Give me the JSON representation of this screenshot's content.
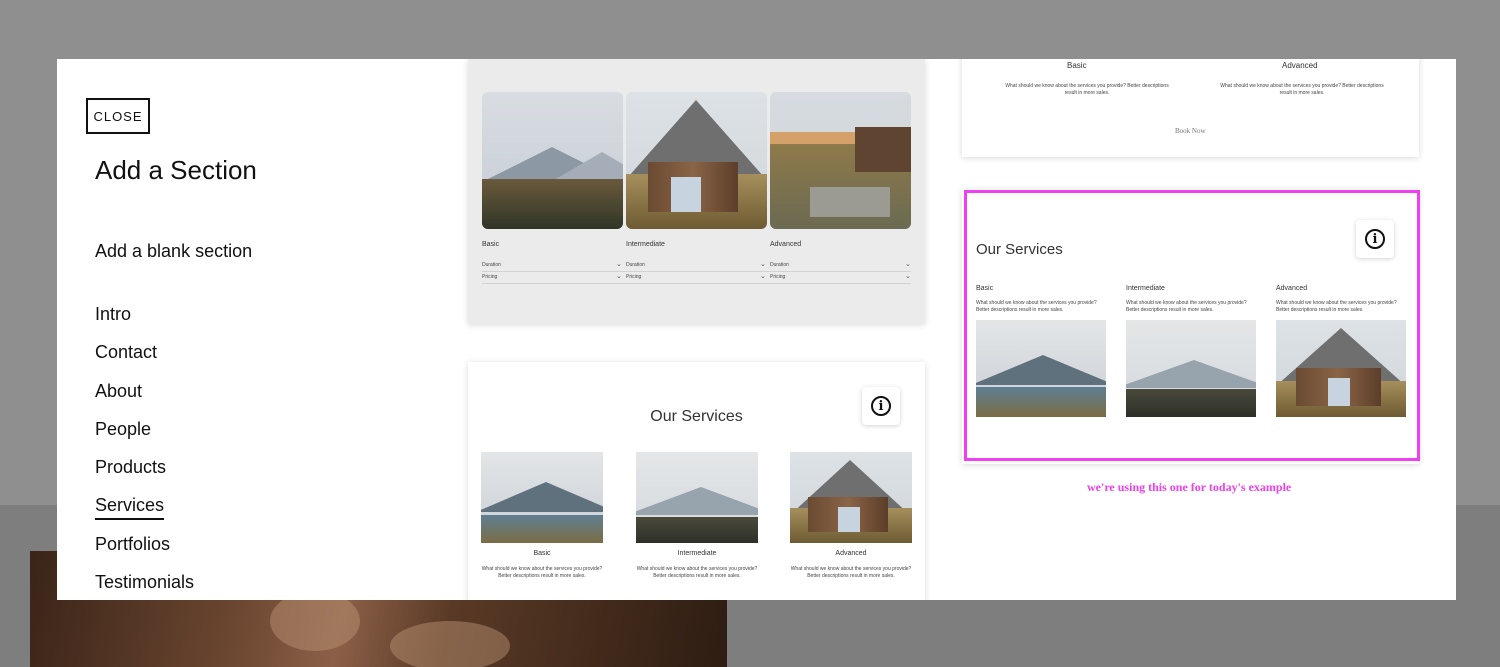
{
  "sidebar": {
    "close_label": "CLOSE",
    "title": "Add a Section",
    "blank_label": "Add a blank section",
    "items": [
      {
        "label": "Intro"
      },
      {
        "label": "Contact"
      },
      {
        "label": "About"
      },
      {
        "label": "People"
      },
      {
        "label": "Products"
      },
      {
        "label": "Services"
      },
      {
        "label": "Portfolios"
      },
      {
        "label": "Testimonials"
      }
    ],
    "active_item": "Services"
  },
  "preview_top_left": {
    "columns": [
      "Basic",
      "Intermediate",
      "Advanced"
    ],
    "rows": [
      "Duration",
      "Pricing"
    ]
  },
  "preview_top_right": {
    "columns": [
      "Basic",
      "Advanced"
    ],
    "description": "What should we know about the services you provide? Better descriptions result in more sales.",
    "cta": "Book Now"
  },
  "preview_bottom_left": {
    "heading": "Our Services",
    "columns": [
      "Basic",
      "Intermediate",
      "Advanced"
    ],
    "description": "What should we know about the services you provide? Better descriptions result in more sales."
  },
  "preview_highlighted": {
    "heading": "Our Services",
    "columns": [
      "Basic",
      "Intermediate",
      "Advanced"
    ],
    "description": "What should we know about the services you provide? Better descriptions result in more sales."
  },
  "annotation": {
    "note": "we're using this one for today's example",
    "color": "#f03ef0"
  },
  "icons": {
    "info": "info-icon",
    "chevron": "chevron-down-icon"
  }
}
